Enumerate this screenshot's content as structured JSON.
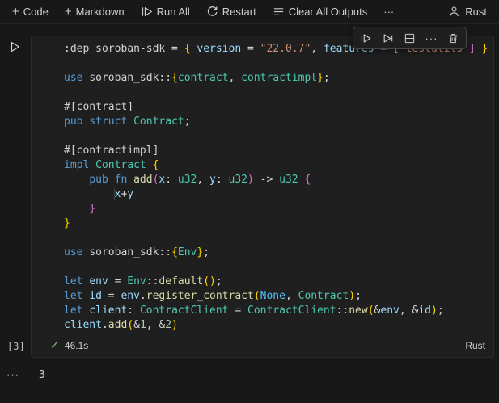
{
  "colors": {
    "background": "#181818",
    "cell_background": "#1f1f1f",
    "keyword": "#569CD6",
    "type": "#4EC9B0",
    "function": "#DCDCAA",
    "variable": "#9CDCFE",
    "string": "#CE9178",
    "number": "#B5CEA8",
    "plain": "#D4D4D4",
    "bracket1": "#FFD700",
    "bracket2": "#DA70D6",
    "enum_member": "#4FC1FF",
    "success": "#89D185"
  },
  "toolbar": {
    "plus_glyph": "+",
    "code_label": "Code",
    "markdown_label": "Markdown",
    "run_all_label": "Run All",
    "restart_label": "Restart",
    "clear_outputs_label": "Clear All Outputs",
    "more_glyph": "···",
    "kernel_label": "Rust"
  },
  "cell_toolbar": {
    "more_glyph": "···"
  },
  "cell": {
    "execution_count": "[3]",
    "footer": {
      "check_glyph": "✓",
      "duration": "46.1s",
      "language": "Rust"
    },
    "lines": [
      [
        [
          ":dep soroban-sdk = ",
          "pl"
        ],
        [
          "{",
          "b1"
        ],
        [
          " ",
          "pl"
        ],
        [
          "version",
          "var"
        ],
        [
          " = ",
          "pl"
        ],
        [
          "\"22.0.7\"",
          "str"
        ],
        [
          ", ",
          "pl"
        ],
        [
          "features",
          "var"
        ],
        [
          " = ",
          "pl"
        ],
        [
          "[",
          "b2"
        ],
        [
          "\"testutils\"",
          "str"
        ],
        [
          "]",
          "b2"
        ],
        [
          " ",
          "pl"
        ],
        [
          "}",
          "b1"
        ]
      ],
      [],
      [
        [
          "use ",
          "kw"
        ],
        [
          "soroban_sdk::",
          "pl"
        ],
        [
          "{",
          "b1"
        ],
        [
          "contract",
          "type"
        ],
        [
          ", ",
          "pl"
        ],
        [
          "contractimpl",
          "type"
        ],
        [
          "}",
          "b1"
        ],
        [
          ";",
          "pl"
        ]
      ],
      [],
      [
        [
          "#[contract]",
          "pl"
        ]
      ],
      [
        [
          "pub struct ",
          "kw"
        ],
        [
          "Contract",
          "type"
        ],
        [
          ";",
          "pl"
        ]
      ],
      [],
      [
        [
          "#[contractimpl]",
          "pl"
        ]
      ],
      [
        [
          "impl ",
          "kw"
        ],
        [
          "Contract ",
          "type"
        ],
        [
          "{",
          "b1"
        ]
      ],
      [
        [
          "    ",
          "pl"
        ],
        [
          "pub fn ",
          "kw"
        ],
        [
          "add",
          "fn"
        ],
        [
          "(",
          "b2"
        ],
        [
          "x",
          "var"
        ],
        [
          ": ",
          "pl"
        ],
        [
          "u32",
          "type"
        ],
        [
          ", ",
          "pl"
        ],
        [
          "y",
          "var"
        ],
        [
          ": ",
          "pl"
        ],
        [
          "u32",
          "type"
        ],
        [
          ")",
          "b2"
        ],
        [
          " -> ",
          "pl"
        ],
        [
          "u32 ",
          "type"
        ],
        [
          "{",
          "b2"
        ]
      ],
      [
        [
          "        ",
          "guide"
        ],
        [
          "x",
          "var"
        ],
        [
          "+",
          "pl"
        ],
        [
          "y",
          "var"
        ]
      ],
      [
        [
          "    ",
          "pl"
        ],
        [
          "}",
          "b2"
        ]
      ],
      [
        [
          "}",
          "b1"
        ]
      ],
      [],
      [
        [
          "use ",
          "kw"
        ],
        [
          "soroban_sdk::",
          "pl"
        ],
        [
          "{",
          "b1"
        ],
        [
          "Env",
          "type"
        ],
        [
          "}",
          "b1"
        ],
        [
          ";",
          "pl"
        ]
      ],
      [],
      [
        [
          "let ",
          "kw"
        ],
        [
          "env",
          "var"
        ],
        [
          " = ",
          "pl"
        ],
        [
          "Env",
          "type"
        ],
        [
          "::",
          "pl"
        ],
        [
          "default",
          "fn"
        ],
        [
          "()",
          "b1"
        ],
        [
          ";",
          "pl"
        ]
      ],
      [
        [
          "let ",
          "kw"
        ],
        [
          "id",
          "var"
        ],
        [
          " = ",
          "pl"
        ],
        [
          "env",
          "var"
        ],
        [
          ".",
          "pl"
        ],
        [
          "register_contract",
          "fn"
        ],
        [
          "(",
          "b1"
        ],
        [
          "None",
          "enum"
        ],
        [
          ", ",
          "pl"
        ],
        [
          "Contract",
          "type"
        ],
        [
          ")",
          "b1"
        ],
        [
          ";",
          "pl"
        ]
      ],
      [
        [
          "let ",
          "kw"
        ],
        [
          "client",
          "var"
        ],
        [
          ": ",
          "pl"
        ],
        [
          "ContractClient",
          "type"
        ],
        [
          " = ",
          "pl"
        ],
        [
          "ContractClient",
          "type"
        ],
        [
          "::",
          "pl"
        ],
        [
          "new",
          "fn"
        ],
        [
          "(",
          "b1"
        ],
        [
          "&",
          "pl"
        ],
        [
          "env",
          "var"
        ],
        [
          ", ",
          "pl"
        ],
        [
          "&",
          "pl"
        ],
        [
          "id",
          "var"
        ],
        [
          ")",
          "b1"
        ],
        [
          ";",
          "pl"
        ]
      ],
      [
        [
          "client",
          "var"
        ],
        [
          ".",
          "pl"
        ],
        [
          "add",
          "fn"
        ],
        [
          "(",
          "b1"
        ],
        [
          "&",
          "pl"
        ],
        [
          "1",
          "num"
        ],
        [
          ", ",
          "pl"
        ],
        [
          "&",
          "pl"
        ],
        [
          "2",
          "num"
        ],
        [
          ")",
          "b1"
        ]
      ]
    ]
  },
  "output": {
    "more_glyph": "···",
    "value": "3"
  }
}
